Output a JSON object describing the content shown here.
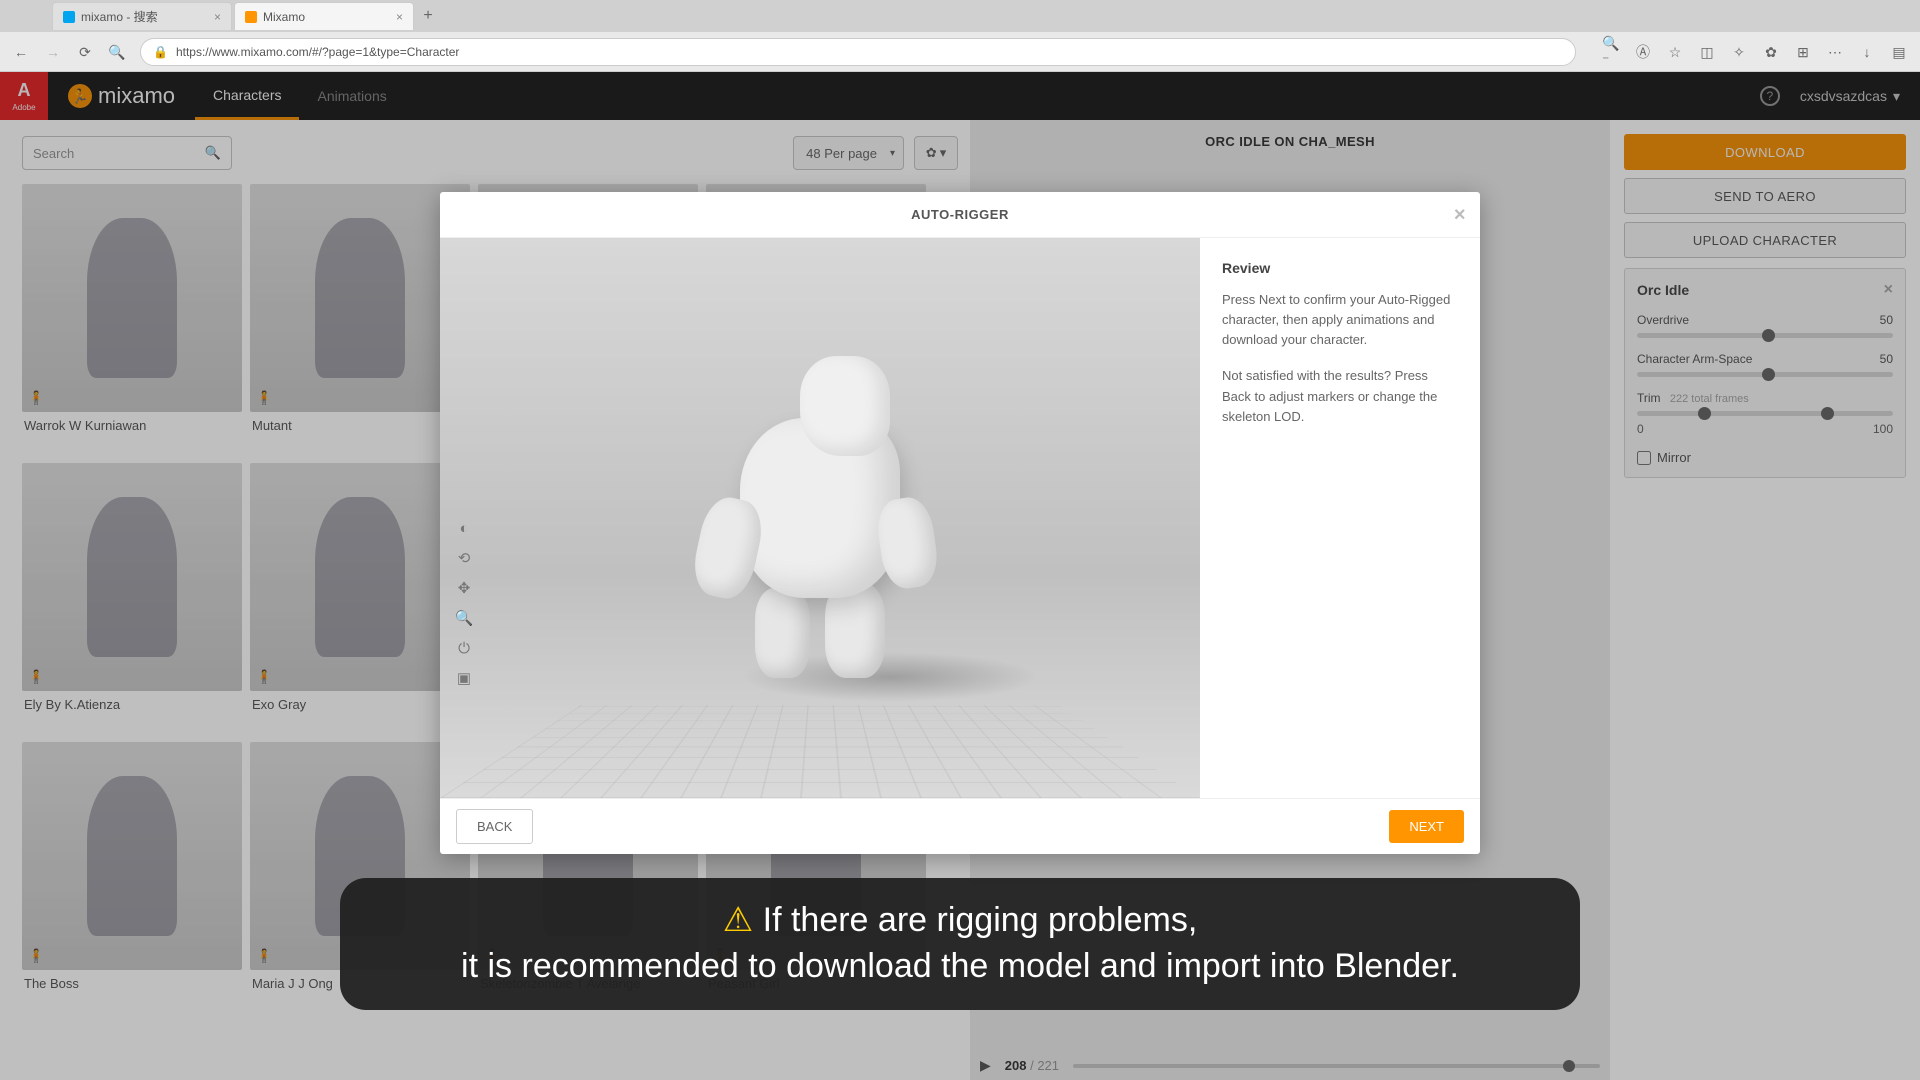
{
  "browser": {
    "tab1": "mixamo - 搜索",
    "tab2": "Mixamo",
    "url": "https://www.mixamo.com/#/?page=1&type=Character"
  },
  "header": {
    "brand": "mixamo",
    "nav_characters": "Characters",
    "nav_animations": "Animations",
    "username": "cxsdvsazdcas"
  },
  "toolbar": {
    "search_placeholder": "Search",
    "perpage": "48 Per page"
  },
  "cards": [
    {
      "name": "Warrok W Kurniawan"
    },
    {
      "name": "Mutant"
    },
    {
      "name": ""
    },
    {
      "name": ""
    },
    {
      "name": "Ely By K.Atienza"
    },
    {
      "name": "Exo Gray"
    },
    {
      "name": ""
    },
    {
      "name": ""
    },
    {
      "name": "The Boss"
    },
    {
      "name": "Maria J J Ong"
    },
    {
      "name": "Skeletonzombie T Avelange"
    },
    {
      "name": "Peasant Girl"
    }
  ],
  "center": {
    "title": "ORC IDLE ON CHA_MESH",
    "frame_current": "208",
    "frame_total": "221"
  },
  "right": {
    "download": "DOWNLOAD",
    "send_to_aero": "SEND TO AERO",
    "upload_character": "UPLOAD CHARACTER",
    "anim_title": "Orc Idle",
    "overdrive_label": "Overdrive",
    "overdrive_value": "50",
    "armspace_label": "Character Arm-Space",
    "armspace_value": "50",
    "trim_label": "Trim",
    "trim_sub": "222 total frames",
    "trim_min": "0",
    "trim_max": "100",
    "mirror": "Mirror"
  },
  "modal": {
    "title": "AUTO-RIGGER",
    "review_heading": "Review",
    "review_p1": "Press Next to confirm your Auto-Rigged character, then apply animations and download your character.",
    "review_p2": "Not satisfied with the results? Press Back to adjust markers or change the skeleton LOD.",
    "back": "BACK",
    "next": "NEXT"
  },
  "caption": {
    "line1": "If there are rigging problems,",
    "line2": "it is recommended to download the model and import into Blender."
  }
}
